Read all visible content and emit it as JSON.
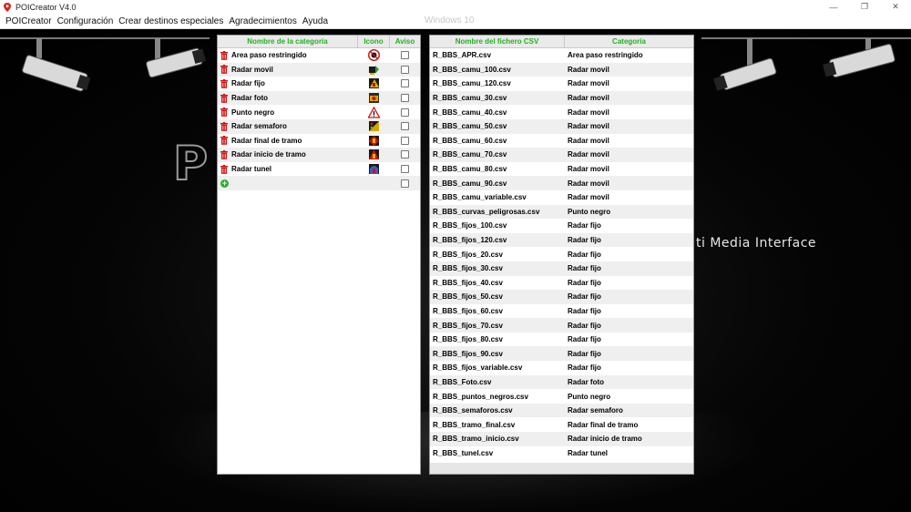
{
  "window": {
    "title": "POICreator V4.0",
    "minimize_glyph": "—",
    "maximize_glyph": "❐",
    "close_glyph": "✕"
  },
  "menu": {
    "items": [
      "POICreator",
      "Configuración",
      "Crear destinos especiales",
      "Agradecimientos",
      "Ayuda"
    ],
    "os_label": "Windows 10"
  },
  "background": {
    "tagline": "ti Media Interface",
    "logo_fragment": "P          R"
  },
  "categories_panel": {
    "headers": {
      "name": "Nombre de la categoría",
      "icon": "Icono",
      "aviso": "Aviso"
    },
    "rows": [
      {
        "name": "Area paso restringido",
        "icon": "no-entry-icon"
      },
      {
        "name": "Radar movil",
        "icon": "mobile-radar-icon"
      },
      {
        "name": "Radar fijo",
        "icon": "fixed-radar-icon"
      },
      {
        "name": "Radar foto",
        "icon": "photo-radar-icon"
      },
      {
        "name": "Punto negro",
        "icon": "warning-triangle-icon"
      },
      {
        "name": "Radar semaforo",
        "icon": "traffic-light-radar-icon"
      },
      {
        "name": "Radar final de tramo",
        "icon": "section-end-radar-icon"
      },
      {
        "name": "Radar inicio de tramo",
        "icon": "section-start-radar-icon"
      },
      {
        "name": "Radar tunel",
        "icon": "tunnel-radar-icon"
      }
    ]
  },
  "files_panel": {
    "headers": {
      "file": "Nombre del fichero CSV",
      "category": "Categoría"
    },
    "rows": [
      {
        "file": "R_BBS_APR.csv",
        "category": "Area paso restringido"
      },
      {
        "file": "R_BBS_camu_100.csv",
        "category": "Radar movil"
      },
      {
        "file": "R_BBS_camu_120.csv",
        "category": "Radar movil"
      },
      {
        "file": "R_BBS_camu_30.csv",
        "category": "Radar movil"
      },
      {
        "file": "R_BBS_camu_40.csv",
        "category": "Radar movil"
      },
      {
        "file": "R_BBS_camu_50.csv",
        "category": "Radar movil"
      },
      {
        "file": "R_BBS_camu_60.csv",
        "category": "Radar movil"
      },
      {
        "file": "R_BBS_camu_70.csv",
        "category": "Radar movil"
      },
      {
        "file": "R_BBS_camu_80.csv",
        "category": "Radar movil"
      },
      {
        "file": "R_BBS_camu_90.csv",
        "category": "Radar movil"
      },
      {
        "file": "R_BBS_camu_variable.csv",
        "category": "Radar movil"
      },
      {
        "file": "R_BBS_curvas_peligrosas.csv",
        "category": "Punto negro"
      },
      {
        "file": "R_BBS_fijos_100.csv",
        "category": "Radar fijo"
      },
      {
        "file": "R_BBS_fijos_120.csv",
        "category": "Radar fijo"
      },
      {
        "file": "R_BBS_fijos_20.csv",
        "category": "Radar fijo"
      },
      {
        "file": "R_BBS_fijos_30.csv",
        "category": "Radar fijo"
      },
      {
        "file": "R_BBS_fijos_40.csv",
        "category": "Radar fijo"
      },
      {
        "file": "R_BBS_fijos_50.csv",
        "category": "Radar fijo"
      },
      {
        "file": "R_BBS_fijos_60.csv",
        "category": "Radar fijo"
      },
      {
        "file": "R_BBS_fijos_70.csv",
        "category": "Radar fijo"
      },
      {
        "file": "R_BBS_fijos_80.csv",
        "category": "Radar fijo"
      },
      {
        "file": "R_BBS_fijos_90.csv",
        "category": "Radar fijo"
      },
      {
        "file": "R_BBS_fijos_variable.csv",
        "category": "Radar fijo"
      },
      {
        "file": "R_BBS_Foto.csv",
        "category": "Radar foto"
      },
      {
        "file": "R_BBS_puntos_negros.csv",
        "category": "Punto negro"
      },
      {
        "file": "R_BBS_semaforos.csv",
        "category": "Radar semaforo"
      },
      {
        "file": "R_BBS_tramo_final.csv",
        "category": "Radar final de tramo"
      },
      {
        "file": "R_BBS_tramo_inicio.csv",
        "category": "Radar inicio de tramo"
      },
      {
        "file": "R_BBS_tunel.csv",
        "category": "Radar tunel"
      }
    ]
  },
  "colors": {
    "header_text": "#21b021",
    "trash_red": "#d01010",
    "add_green": "#27b12c"
  }
}
